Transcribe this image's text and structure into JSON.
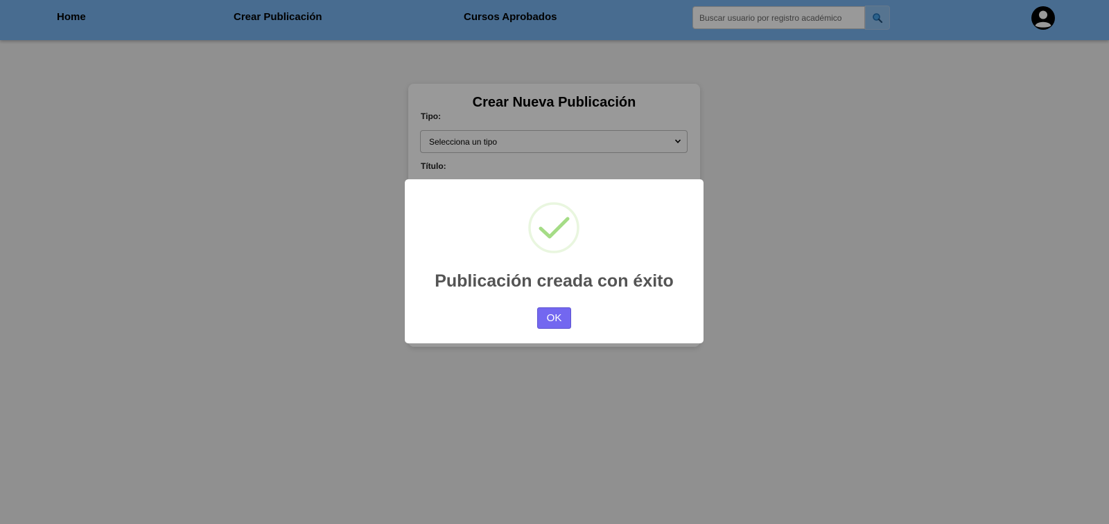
{
  "navbar": {
    "links": {
      "home": "Home",
      "crear": "Crear Publicación",
      "cursos": "Cursos Aprobados"
    },
    "search": {
      "placeholder": "Buscar usuario por registro académico",
      "button_icon": "search-icon"
    },
    "avatar_icon": "user-avatar-icon",
    "color": "#78b4f0"
  },
  "form": {
    "title": "Crear Nueva Publicación",
    "tipo_label": "Tipo:",
    "tipo_select_value": "Selecciona un tipo",
    "titulo_label": "Título:"
  },
  "modal": {
    "icon": "success-check-icon",
    "title": "Publicación creada con éxito",
    "ok_label": "OK",
    "ok_color": "#7367f0",
    "success_color": "#a5dc86"
  }
}
